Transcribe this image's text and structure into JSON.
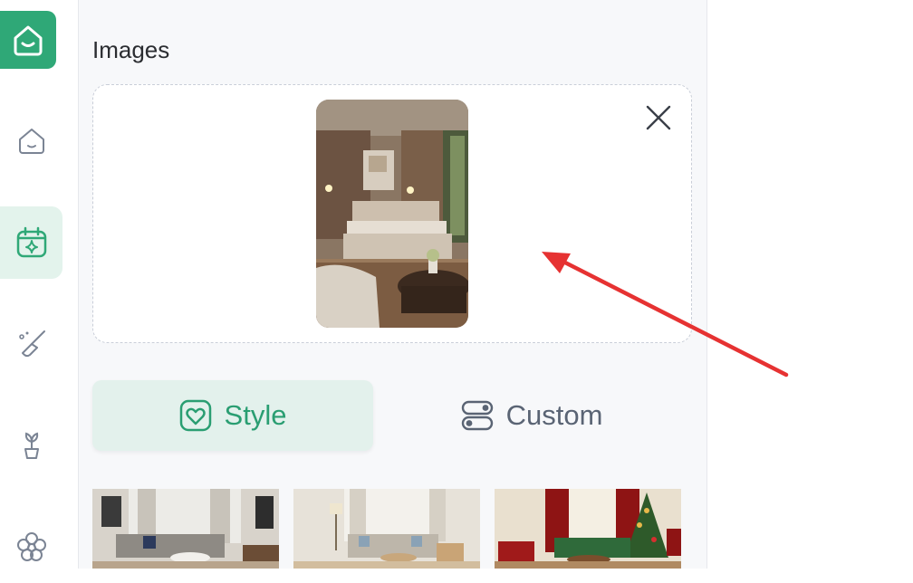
{
  "sidebar": {
    "logo_icon": "home-smile-icon",
    "items": [
      {
        "id": "home",
        "icon": "home-icon",
        "active": false
      },
      {
        "id": "calendar",
        "icon": "calendar-sparkle-icon",
        "active": true
      },
      {
        "id": "clean",
        "icon": "broom-icon",
        "active": false
      },
      {
        "id": "plant",
        "icon": "plant-icon",
        "active": false
      },
      {
        "id": "flower",
        "icon": "flower-icon",
        "active": false
      }
    ]
  },
  "images_section": {
    "title": "Images",
    "close_icon": "close-icon"
  },
  "tabs": [
    {
      "label": "Style",
      "icon": "heart-frame-icon",
      "active": true
    },
    {
      "label": "Custom",
      "icon": "toggle-icon",
      "active": false
    }
  ],
  "colors": {
    "brand": "#2fa877",
    "active_bg": "#e3f3ec",
    "arrow": "#e63232"
  }
}
